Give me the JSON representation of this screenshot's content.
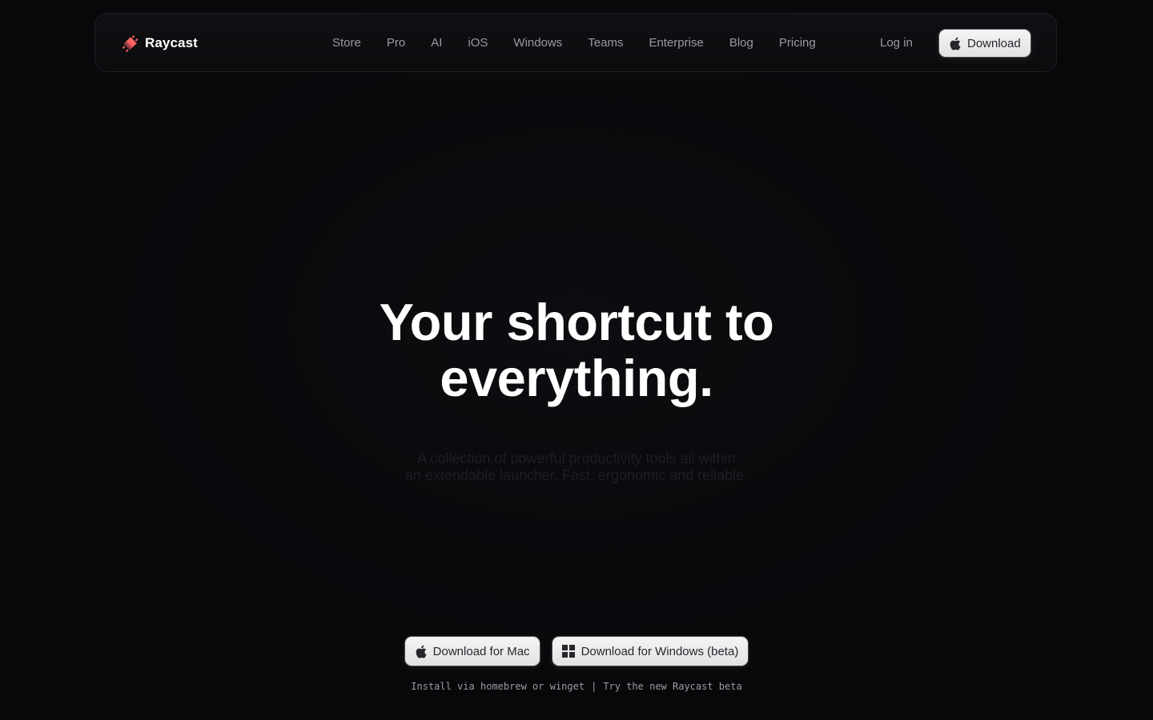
{
  "brand": {
    "name": "Raycast",
    "logo_icon": "raycast-logo-icon",
    "logo_color": "#ff6363"
  },
  "nav": {
    "links": [
      "Store",
      "Pro",
      "AI",
      "iOS",
      "Windows",
      "Teams",
      "Enterprise",
      "Blog",
      "Pricing"
    ],
    "login_label": "Log in",
    "download_label": "Download",
    "download_icon": "apple-icon"
  },
  "hero": {
    "title_line1": "Your shortcut to",
    "title_line2": "everything.",
    "subtitle_line1": "A collection of powerful productivity tools all within",
    "subtitle_line2": "an extendable launcher. Fast, ergonomic and reliable."
  },
  "cta": {
    "mac_label": "Download for Mac",
    "mac_icon": "apple-icon",
    "windows_label": "Download for Windows (beta)",
    "windows_icon": "windows-icon"
  },
  "install": {
    "prefix": "Install via",
    "homebrew": "homebrew",
    "or": "or",
    "winget": "winget",
    "separator": "|",
    "beta_link": "Try the new Raycast beta"
  },
  "colors": {
    "background": "#07080a",
    "accent": "#ff6363",
    "button_bg": "#ececee",
    "nav_text": "#9a9ba1"
  }
}
